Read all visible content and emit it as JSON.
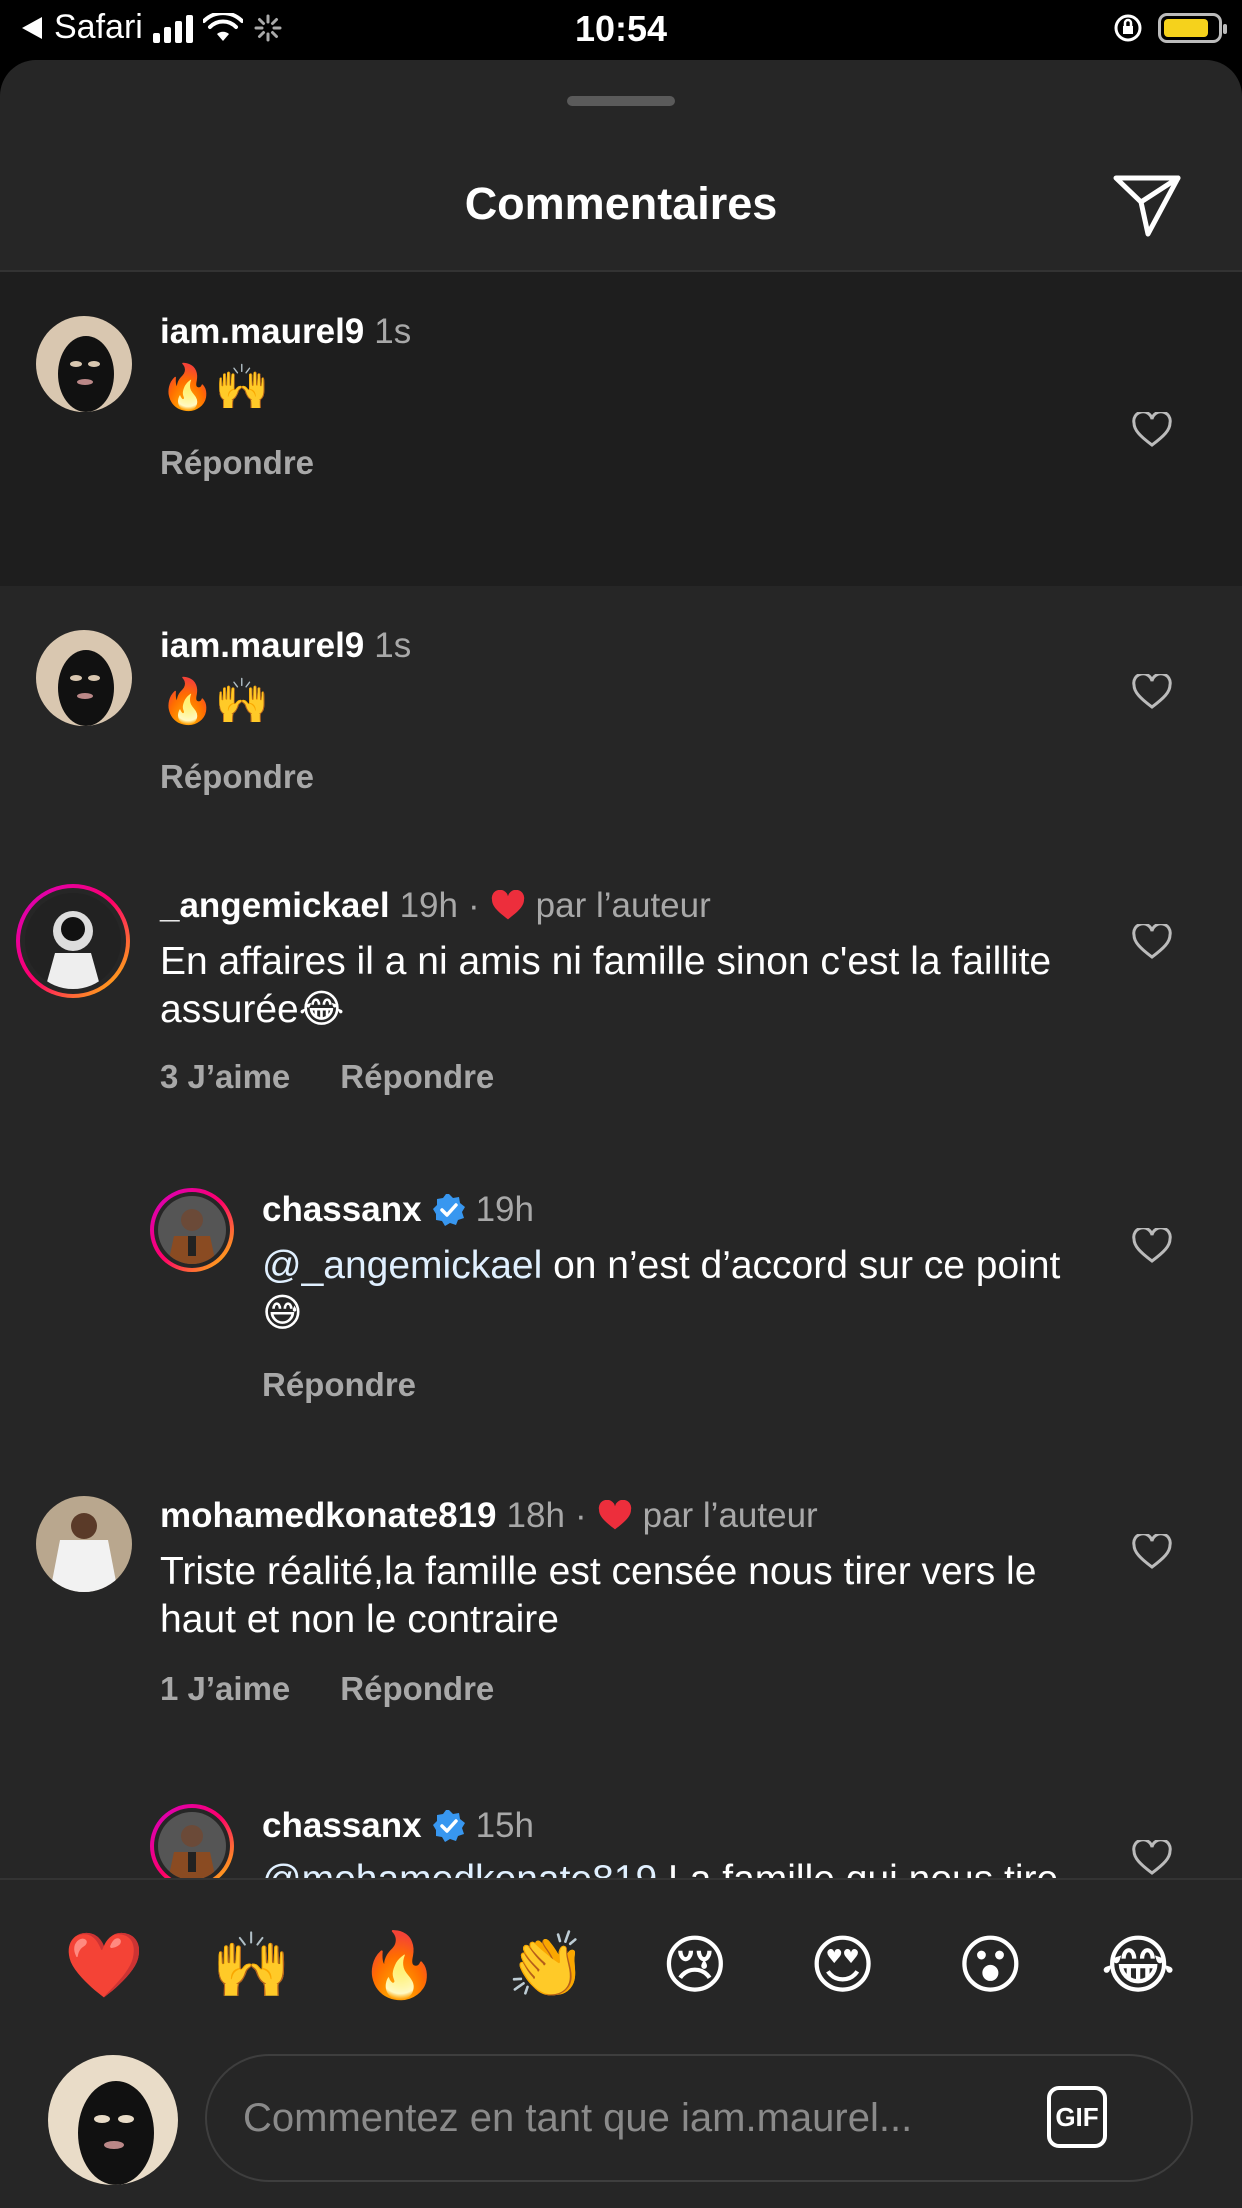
{
  "status_bar": {
    "back_app": "Safari",
    "time": "10:54",
    "battery_level": 0.75
  },
  "header": {
    "title": "Commentaires"
  },
  "comments": [
    {
      "username": "iam.maurel9",
      "time": "1s",
      "text": "🔥🙌",
      "reply_label": "Répondre"
    },
    {
      "username": "iam.maurel9",
      "time": "1s",
      "text": "🔥🙌",
      "reply_label": "Répondre"
    },
    {
      "username": "_angemickael",
      "time": "19h",
      "liked_by_author": "par l’auteur",
      "text": "En affaires il a ni amis ni famille sinon c'est la faillite assurée😂",
      "likes_label": "3 J’aime",
      "reply_label": "Répondre"
    },
    {
      "username": "chassanx",
      "time": "19h",
      "mention": "@_angemickael",
      "text": " on n’est d’accord sur ce point 😅",
      "reply_label": "Répondre"
    },
    {
      "username": "mohamedkonate819",
      "time": "18h",
      "liked_by_author": "par l’auteur",
      "text": "Triste réalité,la famille est censée nous tirer vers le haut et non le contraire",
      "likes_label": "1 J’aime",
      "reply_label": "Répondre"
    },
    {
      "username": "chassanx",
      "time": "15h",
      "mention": "@mohamedkonate819",
      "text": " La famille qui nous tire vers le bas est presque devenu la"
    }
  ],
  "quick_reactions": [
    "❤️",
    "🙌",
    "🔥",
    "👏",
    "😢",
    "😍",
    "😮",
    "😂"
  ],
  "composer": {
    "placeholder": "Commentez en tant que iam.maurel...",
    "gif_label": "GIF"
  },
  "colors": {
    "background": "#262626",
    "highlight_row": "#1e1e1e",
    "secondary_text": "#a8a8a8",
    "verified": "#3897f0",
    "author_heart": "#ed2e3c"
  }
}
